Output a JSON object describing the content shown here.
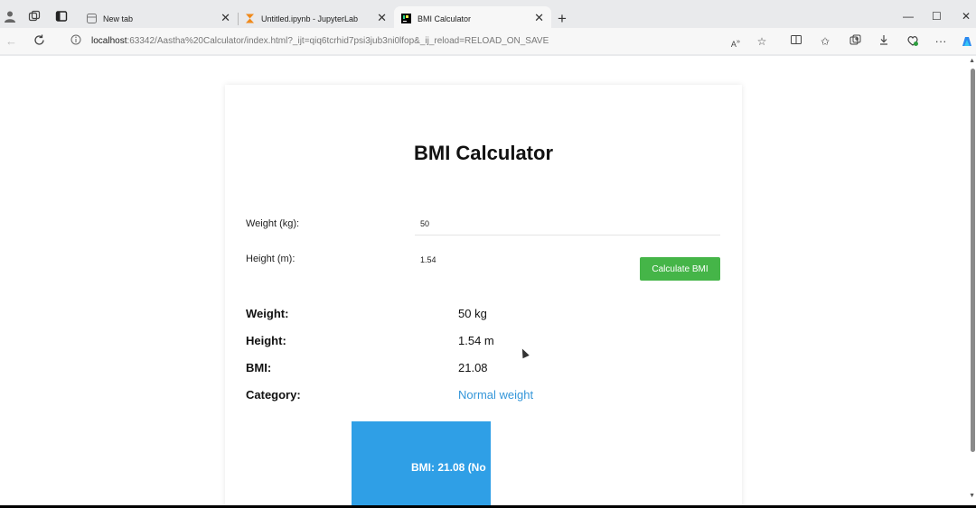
{
  "browser": {
    "tabs": [
      {
        "title": "New tab",
        "close": "✕",
        "active": false
      },
      {
        "title": "Untitled.ipynb - JupyterLab",
        "close": "✕",
        "active": false
      },
      {
        "title": "BMI Calculator",
        "close": "✕",
        "active": true
      }
    ],
    "new_tab_label": "+",
    "url_host": "localhost",
    "url_rest": ":63342/Aastha%20Calculator/index.html?_ijt=qiq6tcrhid7psi3jub3ni0lfop&_ij_reload=RELOAD_ON_SAVE",
    "window_controls": {
      "minimize": "—",
      "maximize": "☐",
      "close": "✕"
    },
    "more_label": "···"
  },
  "page": {
    "title": "BMI Calculator",
    "form": {
      "weight_label": "Weight (kg):",
      "weight_value": "50",
      "height_label": "Height (m):",
      "height_value": "1.54",
      "calculate_label": "Calculate BMI"
    },
    "results": {
      "weight_label": "Weight:",
      "weight_value": "50 kg",
      "height_label": "Height:",
      "height_value": "1.54 m",
      "bmi_label": "BMI:",
      "bmi_value": "21.08",
      "category_label": "Category:",
      "category_value": "Normal weight"
    },
    "bmi_box_text": "BMI: 21.08 (No"
  },
  "colors": {
    "button": "#45b548",
    "category": "#3496d9",
    "bmi_box": "#2f9fe6"
  }
}
